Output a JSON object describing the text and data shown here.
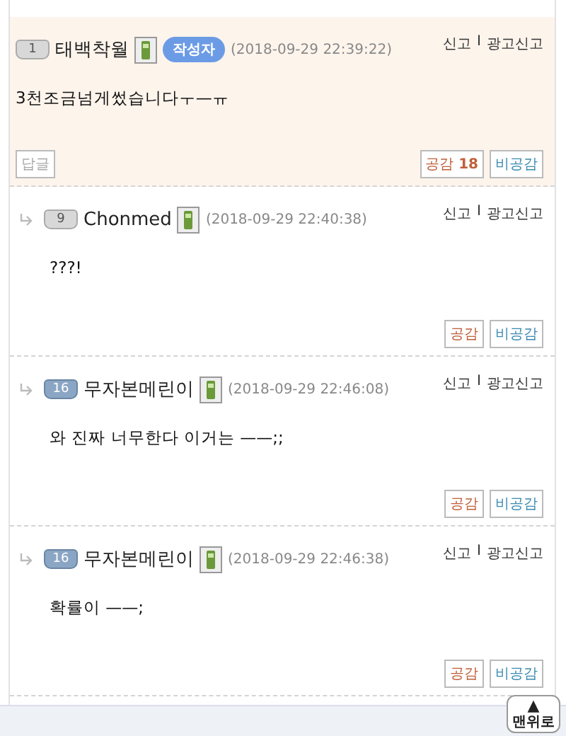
{
  "comments": [
    {
      "highlighted": true,
      "reply": false,
      "level_badge": "1",
      "author": "태백착월",
      "author_tag": "작성자",
      "date": "(2018-09-29 22:39:22)",
      "report": "신고",
      "separator": "I",
      "ad_report": "광고신고",
      "body": "3천조금넘게썼습니다ㅜ—ㅠ",
      "reply_button": "답글",
      "like": "공감",
      "like_count": "18",
      "dislike": "비공감"
    },
    {
      "highlighted": false,
      "reply": true,
      "level_badge": "9",
      "author": "Chonmed",
      "date": "(2018-09-29 22:40:38)",
      "report": "신고",
      "separator": "I",
      "ad_report": "광고신고",
      "body": "???!",
      "like": "공감",
      "dislike": "비공감"
    },
    {
      "highlighted": false,
      "reply": true,
      "level_badge": "16",
      "author": "무자본메린이",
      "date": "(2018-09-29 22:46:08)",
      "report": "신고",
      "separator": "I",
      "ad_report": "광고신고",
      "body": "와 진짜 너무한다 이거는 ——;;",
      "like": "공감",
      "dislike": "비공감"
    },
    {
      "highlighted": false,
      "reply": true,
      "level_badge": "16",
      "author": "무자본메린이",
      "date": "(2018-09-29 22:46:38)",
      "report": "신고",
      "separator": "I",
      "ad_report": "광고신고",
      "body": "확률이 ——;",
      "like": "공감",
      "dislike": "비공감"
    }
  ],
  "top_button": {
    "arrow": "▲",
    "label": "맨위로"
  }
}
